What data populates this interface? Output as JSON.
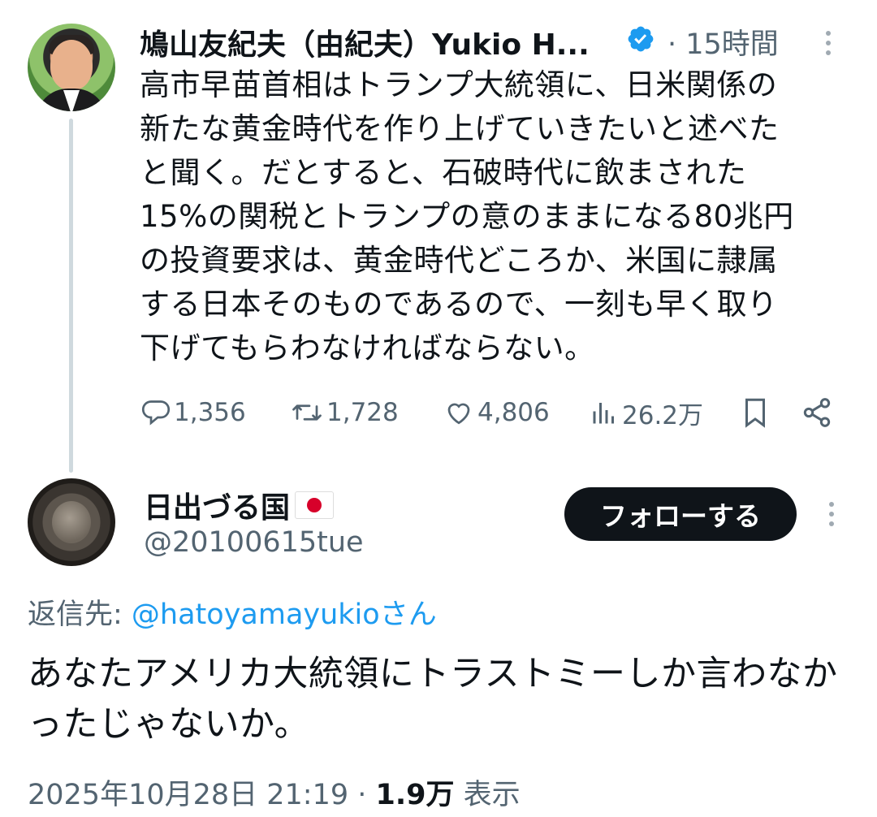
{
  "parent_tweet": {
    "author_name": "鳩山友紀夫（由紀夫）Yukio H...",
    "time": "· 15時間",
    "text": "高市早苗首相はトランプ大統領に、日米関係の\n新たな黄金時代を作り上げていきたいと述べた\nと聞く。だとすると、石破時代に飲まされた\n15%の関税とトランプの意のままになる80兆円\nの投資要求は、黄金時代どころか、米国に隷属\nする日本そのものであるので、一刻も早く取り\n下げてもらわなければならない。",
    "stats": {
      "replies": "1,356",
      "retweets": "1,728",
      "likes": "4,806",
      "views": "26.2万"
    }
  },
  "reply_tweet": {
    "author_name": "日出づる国",
    "handle": "@20100615tue",
    "follow_label": "フォローする",
    "reply_to_label": "返信先: ",
    "reply_to_handle": "@hatoyamayukioさん",
    "text": "あなたアメリカ大統領にトラストミーしか言わなかったじゃないか。",
    "timestamp": "2025年10月28日 21:19 · ",
    "views_count": "1.9万",
    "views_label": " 表示"
  },
  "icons": {
    "verified": "verified-badge-icon",
    "reply": "reply-bubble-icon",
    "retweet": "retweet-icon",
    "like": "heart-icon",
    "views": "views-bar-icon",
    "bookmark": "bookmark-icon",
    "share": "share-icon",
    "more": "more-dots-icon",
    "flag": "japan-flag-icon"
  },
  "colors": {
    "text": "#0f1419",
    "secondary": "#536471",
    "link": "#1d9bf0",
    "verified": "#1d9bf0",
    "button": "#0f1419"
  }
}
